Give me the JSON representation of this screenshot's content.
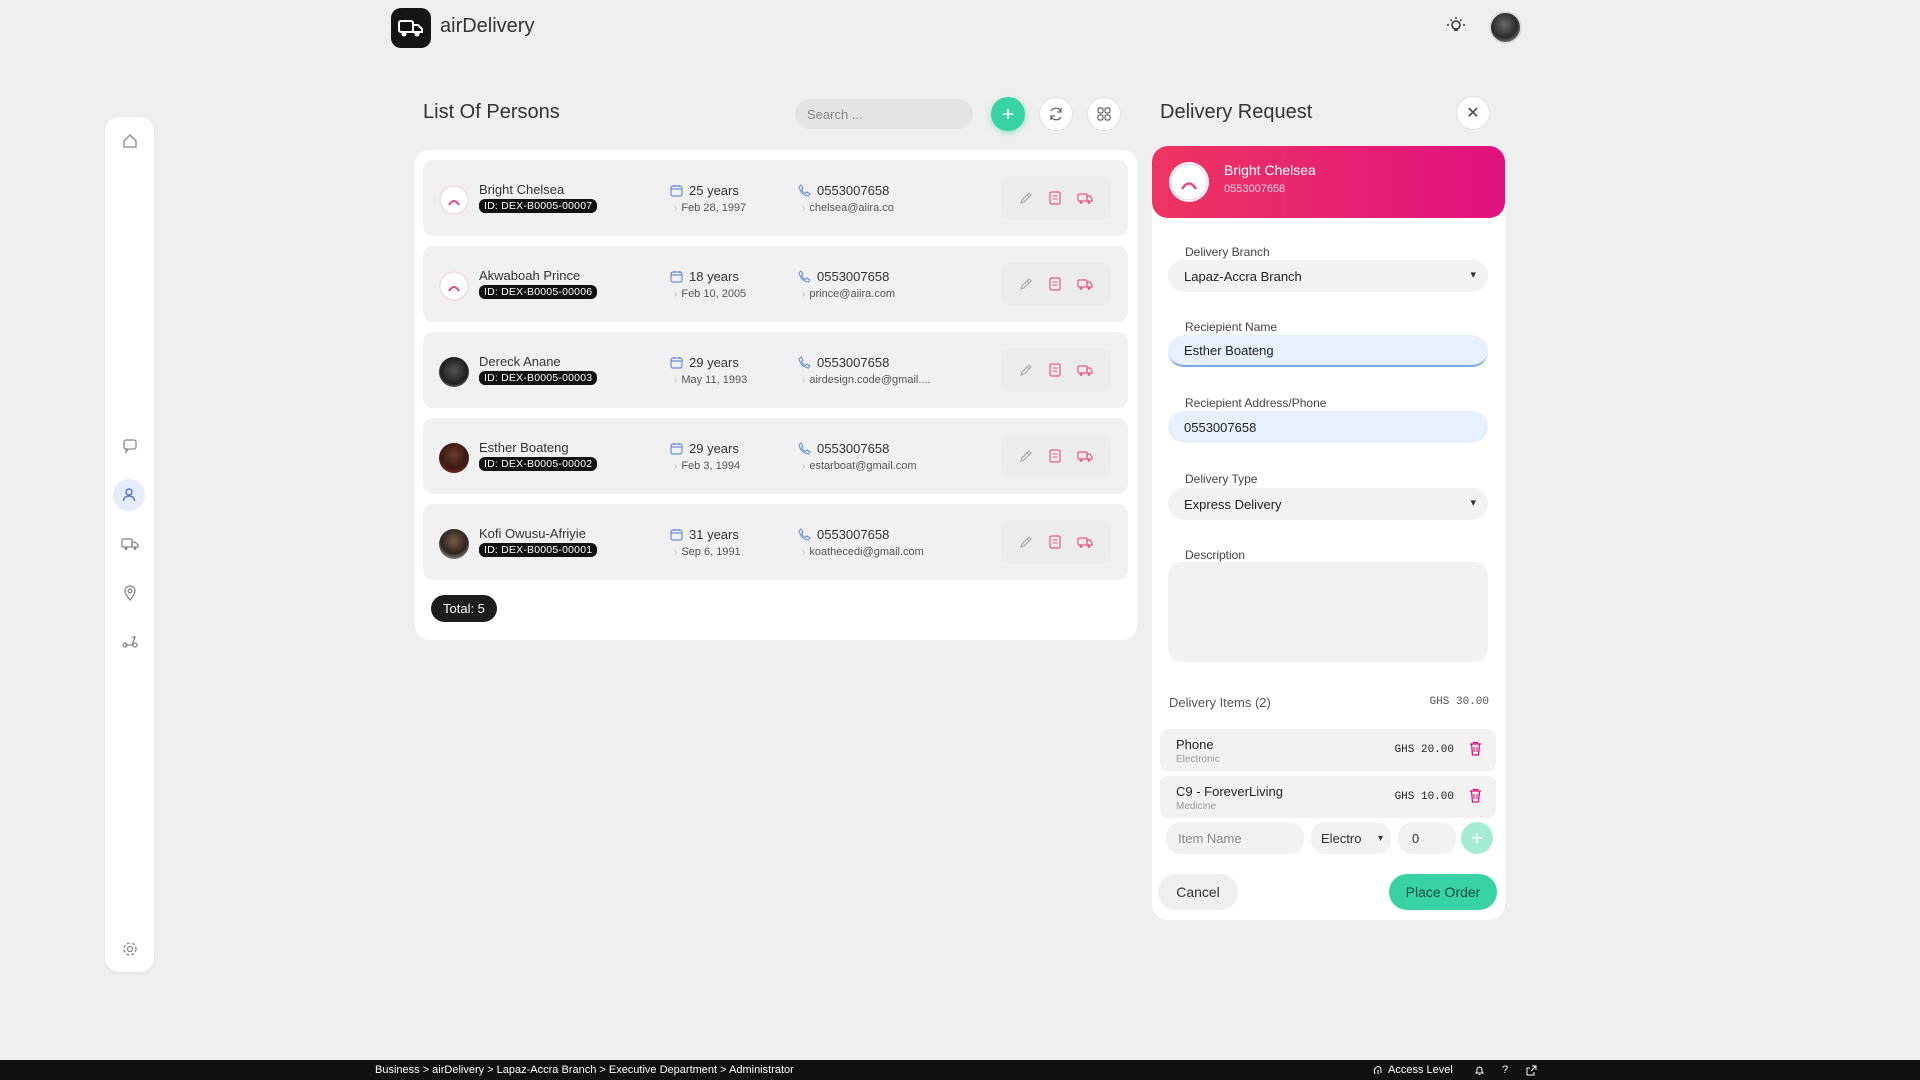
{
  "app": {
    "title": "airDelivery"
  },
  "list": {
    "title": "List Of Persons",
    "search_placeholder": "Search ...",
    "total": "Total: 5",
    "persons": [
      {
        "name": "Bright Chelsea",
        "id": "ID: DEX-B0005-00007",
        "age": "25 years",
        "dob": "Feb 28, 1997",
        "phone": "0553007658",
        "email": "chelsea@aiira.co"
      },
      {
        "name": "Akwaboah Prince",
        "id": "ID: DEX-B0005-00006",
        "age": "18 years",
        "dob": "Feb 10, 2005",
        "phone": "0553007658",
        "email": "prince@aiira.com"
      },
      {
        "name": "Dereck Anane",
        "id": "ID: DEX-B0005-00003",
        "age": "29 years",
        "dob": "May 11, 1993",
        "phone": "0553007658",
        "email": "airdesign.code@gmail...."
      },
      {
        "name": "Esther Boateng",
        "id": "ID: DEX-B0005-00002",
        "age": "29 years",
        "dob": "Feb 3, 1994",
        "phone": "0553007658",
        "email": "estarboat@gmail.com"
      },
      {
        "name": "Kofi Owusu-Afriyie",
        "id": "ID: DEX-B0005-00001",
        "age": "31 years",
        "dob": "Sep 6, 1991",
        "phone": "0553007658",
        "email": "koathecedi@gmail.com"
      }
    ]
  },
  "delivery": {
    "title": "Delivery Request",
    "person_name": "Bright Chelsea",
    "person_phone": "0553007658",
    "branch_label": "Delivery Branch",
    "branch_value": "Lapaz-Accra Branch",
    "recipient_label": "Reciepient Name",
    "recipient_value": "Esther Boateng",
    "address_label": "Reciepient Address/Phone",
    "address_value": "0553007658",
    "type_label": "Delivery Type",
    "type_value": "Express Delivery",
    "description_label": "Description",
    "items_label": "Delivery Items (2)",
    "items_total": "GHS 30.00",
    "items": [
      {
        "name": "Phone",
        "category": "Electronic",
        "price": "GHS 20.00"
      },
      {
        "name": "C9 - ForeverLiving",
        "category": "Medicine",
        "price": "GHS 10.00"
      }
    ],
    "new_item_placeholder": "Item Name",
    "new_item_category": "Electro",
    "new_item_qty": "0",
    "cancel_label": "Cancel",
    "order_label": "Place Order"
  },
  "statusbar": {
    "breadcrumb": "Business > airDelivery > Lapaz-Accra Branch > Executive Department > Administrator",
    "access_label": "Access Level"
  },
  "colors": {
    "accent": "#39d3a3",
    "brand_pink": "#e0117f",
    "brand_red": "#ee3562",
    "icon_pink": "#e8578a"
  },
  "icons": [
    "home-icon",
    "chat-icon",
    "person-icon",
    "truck-icon",
    "location-icon",
    "scooter-icon",
    "settings-icon"
  ]
}
